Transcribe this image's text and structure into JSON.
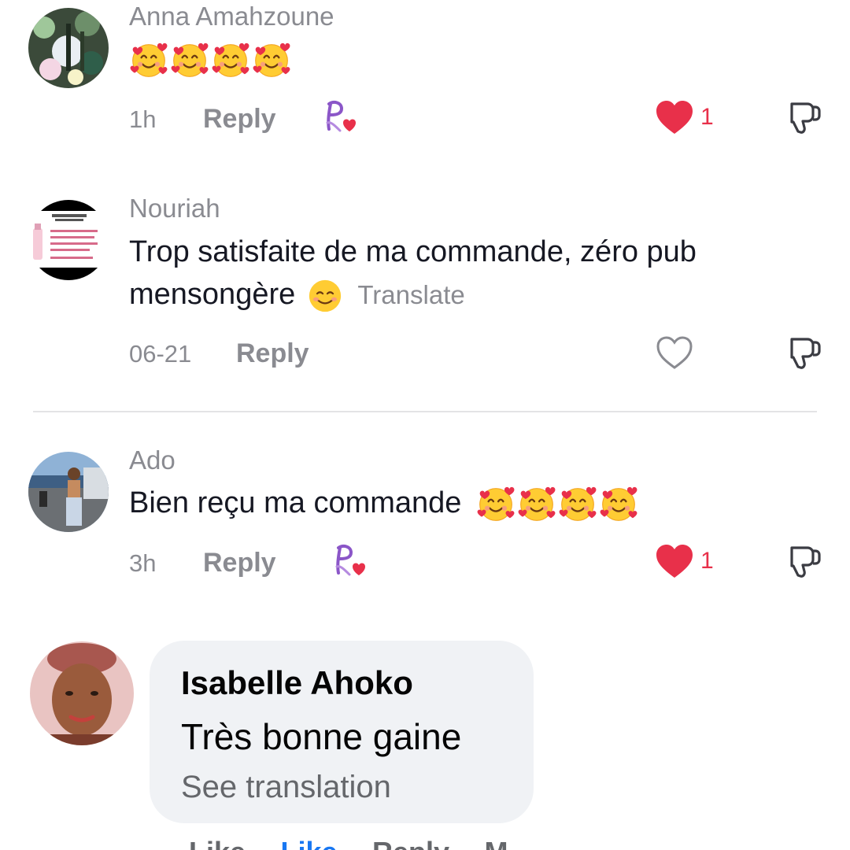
{
  "comments": [
    {
      "username": "Anna Amahzoune",
      "emoji_count": 4,
      "time": "1h",
      "reply": "Reply",
      "likes": "1",
      "liked": true,
      "creator_liked": true
    },
    {
      "username": "Nouriah",
      "text": "Trop satisfaite de ma commande, zéro pub mensongère",
      "translate": "Translate",
      "time": "06-21",
      "reply": "Reply",
      "liked": false,
      "creator_liked": false
    },
    {
      "username": "Ado",
      "text": "Bien reçu ma commande",
      "emoji_count": 4,
      "time": "3h",
      "reply": "Reply",
      "likes": "1",
      "liked": true,
      "creator_liked": true
    }
  ],
  "fb_comment": {
    "name": "Isabelle Ahoko",
    "text": "Très bonne gaine",
    "see_translation": "See translation",
    "action_links": [
      "Like",
      "Like",
      "Reply",
      "M"
    ]
  },
  "colors": {
    "like_red": "#e8304a",
    "muted_gray": "#8a8b91",
    "bubble_bg": "#f0f2f5",
    "creator_badge_purple": "#8b56c8"
  },
  "icons": [
    "heart-filled-icon",
    "heart-outline-icon",
    "dislike-icon",
    "creator-liked-badge-icon",
    "smiling-face-with-hearts-emoji",
    "smiling-face-emoji"
  ]
}
